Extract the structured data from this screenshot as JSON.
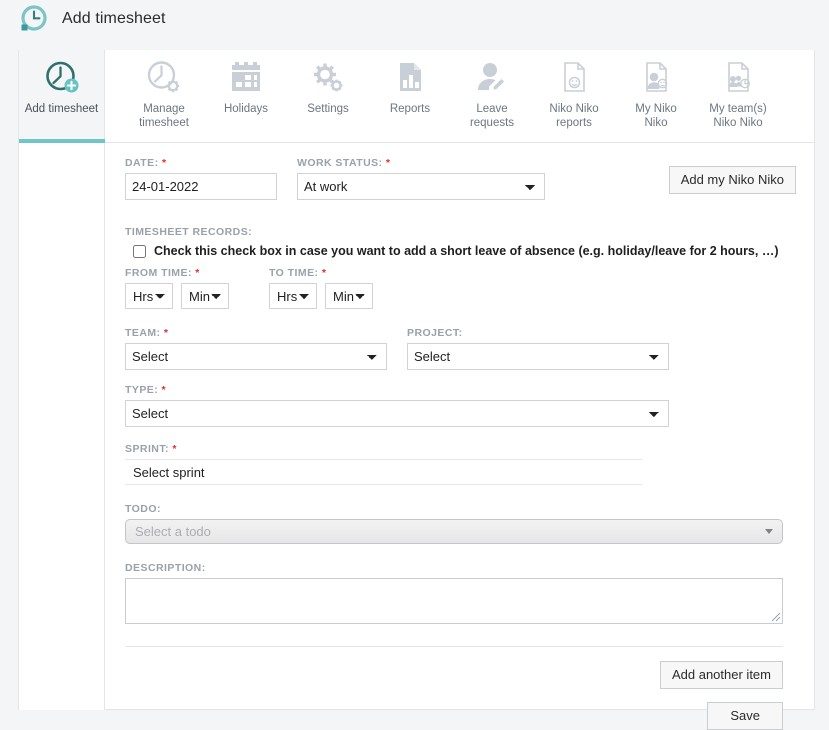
{
  "header": {
    "title": "Add timesheet",
    "icon": "clock-icon"
  },
  "tabs": [
    {
      "label": "Add timesheet",
      "icon": "clock-plus-icon",
      "active": true
    },
    {
      "label": "Manage\ntimesheet",
      "icon": "clock-gear-icon",
      "active": false
    },
    {
      "label": "Holidays",
      "icon": "calendar-icon",
      "active": false
    },
    {
      "label": "Settings",
      "icon": "gears-icon",
      "active": false
    },
    {
      "label": "Reports",
      "icon": "bar-chart-doc-icon",
      "active": false
    },
    {
      "label": "Leave requests",
      "icon": "person-edit-icon",
      "active": false
    },
    {
      "label": "Niko Niko\nreports",
      "icon": "doc-smiley-icon",
      "active": false
    },
    {
      "label": "My Niko\nNiko",
      "icon": "doc-person-smiley-icon",
      "active": false
    },
    {
      "label": "My team(s)\nNiko Niko",
      "icon": "doc-team-smiley-icon",
      "active": false
    }
  ],
  "form": {
    "date": {
      "label": "DATE:",
      "required": "*",
      "value": "24-01-2022"
    },
    "work_status": {
      "label": "WORK STATUS:",
      "required": "*",
      "value": "At work",
      "options": [
        "At work"
      ]
    },
    "add_niko_button": "Add my Niko Niko",
    "timesheet_records_label": "TIMESHEET RECORDS:",
    "short_leave_checkbox": {
      "checked": false,
      "label": "Check this check box in case you want to add a short leave of absence (e.g. holiday/leave for 2 hours, …)"
    },
    "from_time": {
      "label": "FROM TIME:",
      "required": "*",
      "hours_value": "Hrs",
      "minutes_value": "Min"
    },
    "to_time": {
      "label": "TO TIME:",
      "required": "*",
      "hours_value": "Hrs",
      "minutes_value": "Min"
    },
    "team": {
      "label": "TEAM:",
      "required": "*",
      "value": "Select",
      "options": [
        "Select"
      ]
    },
    "project": {
      "label": "PROJECT:",
      "required": "",
      "value": "Select",
      "options": [
        "Select"
      ]
    },
    "type": {
      "label": "TYPE:",
      "required": "*",
      "value": "Select",
      "options": [
        "Select"
      ]
    },
    "sprint": {
      "label": "SPRINT:",
      "required": "*",
      "value": "Select sprint",
      "placeholder": "Select sprint"
    },
    "todo": {
      "label": "TODO:",
      "required": "",
      "placeholder": "Select a todo",
      "value": "Select a todo"
    },
    "description": {
      "label": "DESCRIPTION:",
      "required": "",
      "value": "",
      "placeholder": ""
    },
    "add_another_item_button": "Add another item",
    "save_button": "Save"
  },
  "colors": {
    "accent_teal": "#6ec6c9",
    "icon_dark_teal": "#2f7f7d",
    "icon_grey": "#c9cfd6",
    "required_red": "#e03030",
    "page_bg": "#f4f5f7"
  }
}
